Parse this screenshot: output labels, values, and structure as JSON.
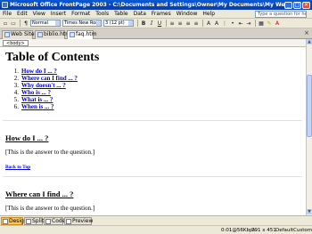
{
  "window": {
    "title": "Microsoft Office FrontPage 2003 - C:\\Documents and Settings\\Owner\\My Documents\\My Web Sites\\mysite/..."
  },
  "menu": [
    "File",
    "Edit",
    "View",
    "Insert",
    "Format",
    "Tools",
    "Table",
    "Data",
    "Frames",
    "Window",
    "Help"
  ],
  "help_placeholder": "Type a question for help",
  "toolbar": {
    "style": "Normal",
    "font": "Times New Roman",
    "size": "3 (12 pt)",
    "bold": "B",
    "italic": "I",
    "underline": "U"
  },
  "tabs": [
    "Web Site",
    "biblio.htm",
    "faq.htm"
  ],
  "active_tab": "faq.htm",
  "tag_chip": "<body>",
  "document": {
    "title": "Table of Contents",
    "toc": [
      {
        "num": "1.",
        "text": "How do I ... ?"
      },
      {
        "num": "2.",
        "text": "Where can I find ... ?"
      },
      {
        "num": "3.",
        "text": "Why doesn't ... ?"
      },
      {
        "num": "4.",
        "text": "Who is ... ?"
      },
      {
        "num": "5.",
        "text": "What is ... ?"
      },
      {
        "num": "6.",
        "text": "When is ... ?"
      }
    ],
    "section1_heading": "How do I ... ?",
    "section1_answer": "[This is the answer to the question.]",
    "back_to_top": "Back to Top",
    "section2_heading": "Where can I find ... ?",
    "section2_answer": "[This is the answer to the question.]"
  },
  "views": [
    "Design",
    "Split",
    "Code",
    "Preview"
  ],
  "active_view": "Design",
  "status": {
    "time": "0:01@56Kbps",
    "dimensions": "791 x 451",
    "mode": "Default",
    "style": "Custom"
  },
  "colors": {
    "title_bar": "#0843b8",
    "link": "#0000ee",
    "active_view": "#f6c567"
  }
}
